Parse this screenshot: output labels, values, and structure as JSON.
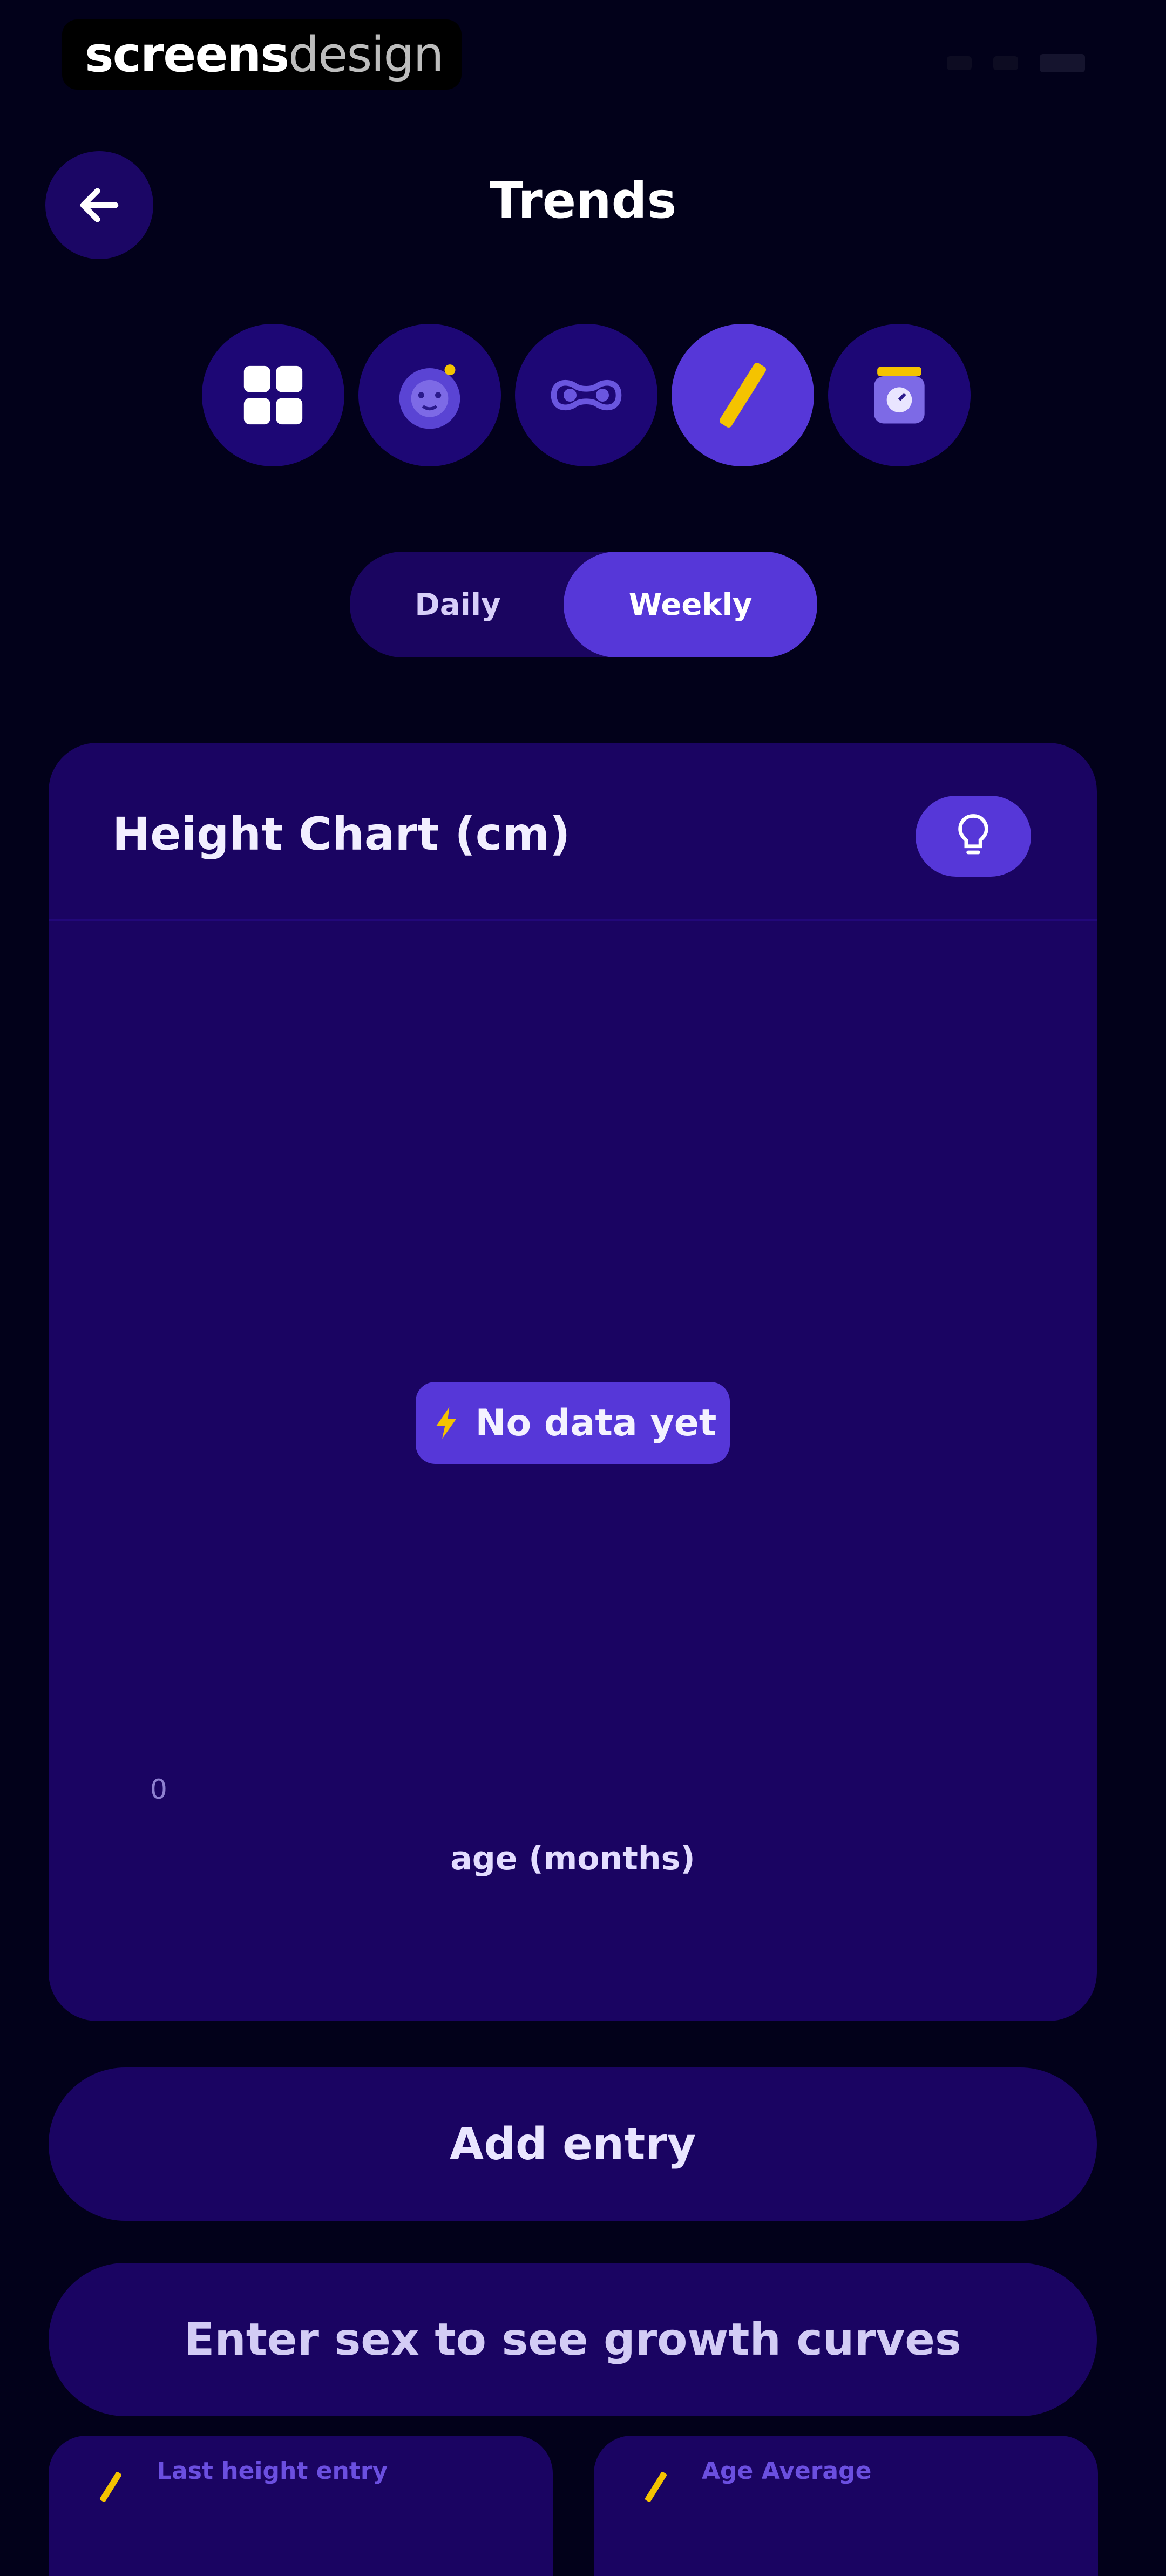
{
  "watermark": {
    "part1": "screens",
    "part2": "design"
  },
  "header": {
    "title": "Trends"
  },
  "categories": [
    {
      "icon": "dashboard-grid-icon",
      "active": false
    },
    {
      "icon": "baby-face-icon",
      "active": false
    },
    {
      "icon": "sleep-mask-icon",
      "active": false
    },
    {
      "icon": "ruler-icon",
      "active": true
    },
    {
      "icon": "weight-scale-icon",
      "active": false
    }
  ],
  "period_toggle": {
    "daily": "Daily",
    "weekly": "Weekly",
    "selected": "Weekly"
  },
  "chart_card": {
    "title": "Height Chart (cm)",
    "empty_state": "No data yet",
    "axis_zero": "0",
    "x_axis_label": "age (months)"
  },
  "actions": {
    "add_entry": "Add entry",
    "enter_sex": "Enter sex to see growth curves"
  },
  "stats": {
    "last_entry_label": "Last height entry",
    "age_average_label": "Age Average"
  },
  "colors": {
    "background": "#02011a",
    "card": "#1a0462",
    "accent": "#5637d8",
    "highlight_yellow": "#f4c300"
  }
}
